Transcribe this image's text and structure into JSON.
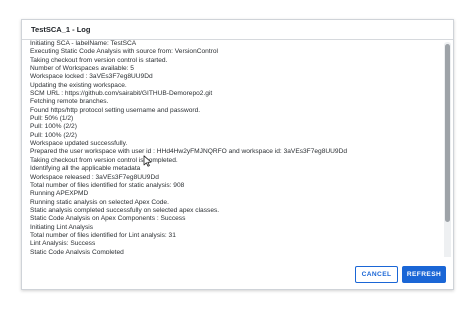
{
  "dialog": {
    "title": "TestSCA_1 - Log"
  },
  "log": {
    "lines": [
      "Initiating SCA - labelName: TestSCA",
      "Executing Static Code Analysis with source from: VersionControl",
      "Taking checkout from version control is started.",
      "Number of Workspaces available: 5",
      "Workspace locked : 3aVEs3F7eg8UU9Dd",
      "Updating the existing workspace.",
      "SCM URL : https://github.com/sairabit/GITHUB-Demorepo2.git",
      "Fetching remote branches.",
      "Found https/http protocol setting username and password.",
      "Pull: 50% (1/2)",
      "Pull: 100% (2/2)",
      "Pull: 100% (2/2)",
      "Workspace updated successfully.",
      "Prepared the user workspace with user id : HHd4Hw2yFMJNQRFO and workspace id: 3aVEs3F7eg8UU9Dd",
      "Taking checkout from version control is completed.",
      "Identifying all the applicable metadata",
      "Workspace released : 3aVEs3F7eg8UU9Dd",
      "Total number of files identified for static analysis: 908",
      "Running APEXPMD",
      "Running static analysis on selected Apex Code.",
      "Static analysis completed successfully on selected apex classes.",
      "Static Code Analysis on Apex Components : Success",
      "Initiating Lint Analysis",
      "Total number of files identified for Lint analysis: 31",
      "Lint Analysis: Success",
      "Static Code Analysis Completed"
    ]
  },
  "footer": {
    "cancel_label": "CANCEL",
    "refresh_label": "REFRESH"
  },
  "colors": {
    "accent": "#1a66d6",
    "text": "#2b2f33",
    "border": "#cfd3d8"
  },
  "icons": {
    "cursor": "mouse-pointer-icon"
  }
}
